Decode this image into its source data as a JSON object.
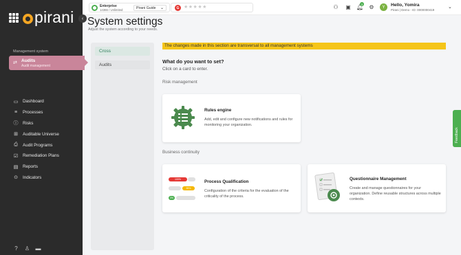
{
  "brand": {
    "name": "pirani",
    "accent": "#c9859a",
    "logo_color": "#f5a623"
  },
  "sidebar": {
    "section_label": "Management system",
    "active": {
      "title": "Audits",
      "subtitle": "Audit management"
    },
    "items": [
      {
        "label": "Dashboard",
        "icon": "monitor-icon"
      },
      {
        "label": "Processes",
        "icon": "processes-icon"
      },
      {
        "label": "Risks",
        "icon": "risk-icon"
      },
      {
        "label": "Auditable Universe",
        "icon": "grid-icon"
      },
      {
        "label": "Audit Programs",
        "icon": "audit-program-icon"
      },
      {
        "label": "Remediation Plans",
        "icon": "checklist-icon"
      },
      {
        "label": "Reports",
        "icon": "reports-icon"
      },
      {
        "label": "Indicators",
        "icon": "indicators-icon"
      }
    ]
  },
  "topbar": {
    "env_name": "Enterprise",
    "env_plan": "14366 / Unlimited",
    "guide": "Pirani Guide",
    "rating_icon": "G",
    "stars": "★★★★★",
    "notifications": "3",
    "user": {
      "initial": "Y",
      "greeting": "Hello, Yomira",
      "org": "Pirani | Demo - ID: 0000000419"
    }
  },
  "page": {
    "title": "System settings",
    "subtitle": "Adjust the system according to your needs."
  },
  "panel": {
    "tabs": [
      "Cross",
      "Audits"
    ]
  },
  "main": {
    "banner": "The changes made in this section are transversal to all management systems",
    "question": "What do you want to set?",
    "hint": "Click on a card to enter.",
    "sections": [
      {
        "title": "Risk management",
        "cards": [
          {
            "title": "Rules engine",
            "desc": "Add, edit and configure new notifications and rules for monitoring your organization."
          }
        ]
      },
      {
        "title": "Business continuity",
        "cards": [
          {
            "title": "Process Qualification",
            "desc": "Configuration of the criteria for the evaluation of the criticality of the process."
          },
          {
            "title": "Questionnaire Management",
            "desc": "Create and manage questionnaires for your organization. Define reusable structures across multiple contexts."
          }
        ]
      }
    ],
    "pq_badges": [
      "100%",
      "55%",
      "0%"
    ]
  },
  "feedback": "Feedback"
}
